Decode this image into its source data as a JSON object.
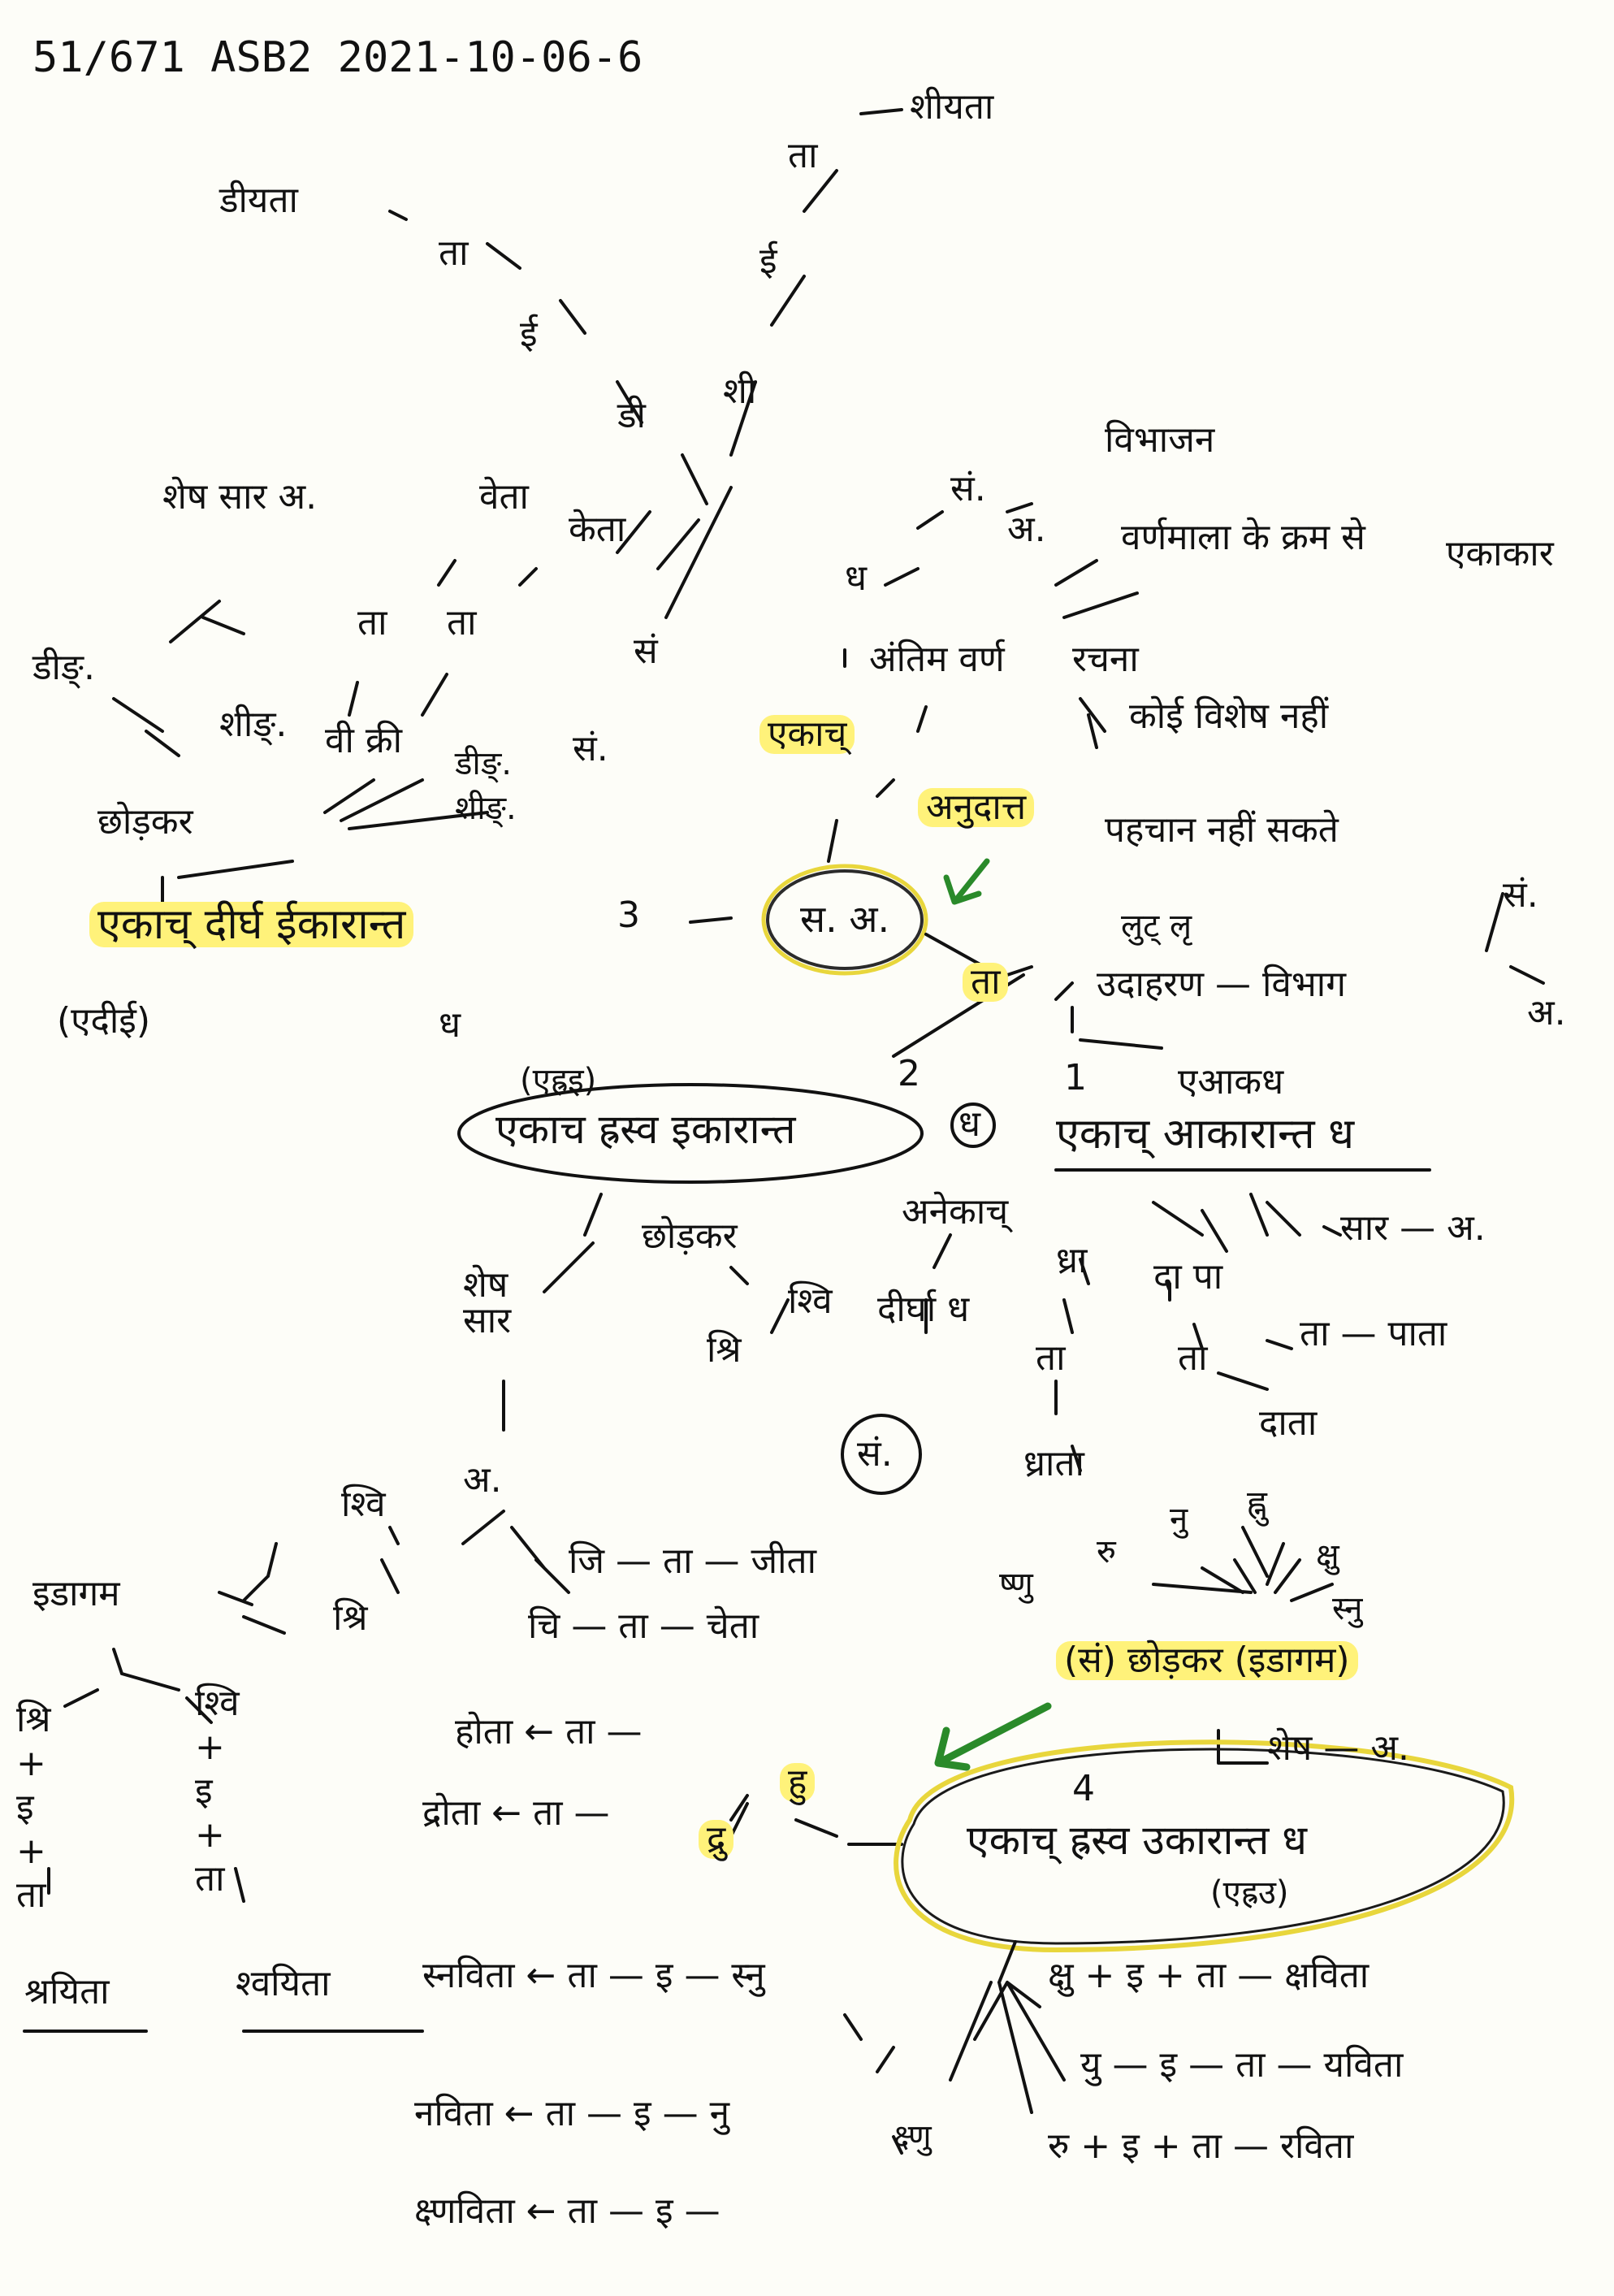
{
  "header": "51/671 ASB2 2021-10-06-6",
  "top_chain": {
    "result": "शीयता",
    "ta": "ता",
    "i": "ई",
    "shi": "शी",
    "left_result": "डीयता",
    "left_ta": "ता",
    "left_i": "ई",
    "di": "डी",
    "sa": "सं",
    "sa_a": "सं."
  },
  "left_top": {
    "shesh_sar": "शेष सार अ.",
    "veta": "वेता",
    "keta": "केता",
    "ta1": "ता",
    "ta2": "ता",
    "vi_kri": "वी क्री",
    "did": "डीङ्.",
    "shid": "शीङ्.",
    "did2": "डीङ्.",
    "shid2": "शीङ्.",
    "chhodkar": "छोड़कर"
  },
  "main_left": {
    "label": "एकाच् दीर्घ ईकारान्त",
    "number": "3",
    "paren": "(एदीई)",
    "dha": "ध"
  },
  "center": {
    "node": "स. अ.",
    "ta": "ता",
    "anudatt": "अनुदात्त",
    "ekach": "एकाच्",
    "antim_varna": "अंतिम वर्ण",
    "dha": "ध",
    "sa": "सं.",
    "a": "अ.",
    "vibhajan": "विभाजन",
    "varnamala": "वर्णमाला के क्रम से",
    "ekakar": "एकाकार",
    "rachna": "रचना",
    "koi_vishesh": "कोई विशेष नहीं",
    "pahchan": "पहचान नहीं सकते"
  },
  "right": {
    "lut": "लुट् लृ",
    "udaharan": "उदाहरण — विभाग",
    "sa": "सं.",
    "a": "अ."
  },
  "branch1": {
    "number": "1",
    "ekakdha": "एआकध",
    "label": "एकाच् आकारान्त ध",
    "anekach": "अनेकाच्",
    "sar_a": "सार — अ.",
    "dhra": "ध्रा",
    "ta": "ता",
    "dhrata": "ध्राता",
    "da_pa": "दा पा",
    "ta2": "ता",
    "pata": "ता — पाता",
    "data": "दाता"
  },
  "branch2": {
    "number": "2",
    "paren": "(एह्रइ)",
    "label": "एकाच ह्रस्व इकारान्त",
    "dha": "ध",
    "chhodkar": "छोड़कर",
    "shri": "श्रि",
    "shvi": "श्वि",
    "shesh_sar": "शेष सार",
    "dirgha": "दीर्घा ध",
    "sa_circle": "सं.",
    "a": "अ."
  },
  "bottom_left": {
    "shvi": "श्वि",
    "shri": "श्रि",
    "jita_row": "जि — ता — जीता",
    "chita_row": "चि — ता — चेता",
    "idagam": "इडागम",
    "shri_col": [
      "श्रि",
      "+",
      "इ",
      "+",
      "ता"
    ],
    "shri_res": "श्रयिता",
    "shvi_col": [
      "श्वि",
      "+",
      "इ",
      "+",
      "ता"
    ],
    "shvi_res": "श्वयिता"
  },
  "middle_bottom": {
    "hota": "होता ← ता —",
    "hu": "हु",
    "drota": "द्रोता ← ता —",
    "dru": "द्रु"
  },
  "branch4": {
    "u_letters": [
      "रु",
      "नु",
      "ह्नु",
      "क्षु",
      "ष्णु",
      "स्नु"
    ],
    "chhodkar": "(सं) छोड़कर (इडागम)",
    "shesh": "शेष — अ.",
    "number": "4",
    "label": "एकाच् ह्रस्व उकारान्त ध",
    "paren": "(एह्रउ)",
    "snavita": "स्नविता ← ता — इ — स्नु",
    "navita": "नविता ← ता — इ — नु",
    "kshnavita": "क्ष्णविता ← ता — इ —",
    "kshnu": "क्ष्णु",
    "kshavita": "क्षु + इ + ता — क्षविता",
    "yavita": "यु — इ — ता — यविता",
    "ravita": "रु + इ + ता — रविता"
  }
}
